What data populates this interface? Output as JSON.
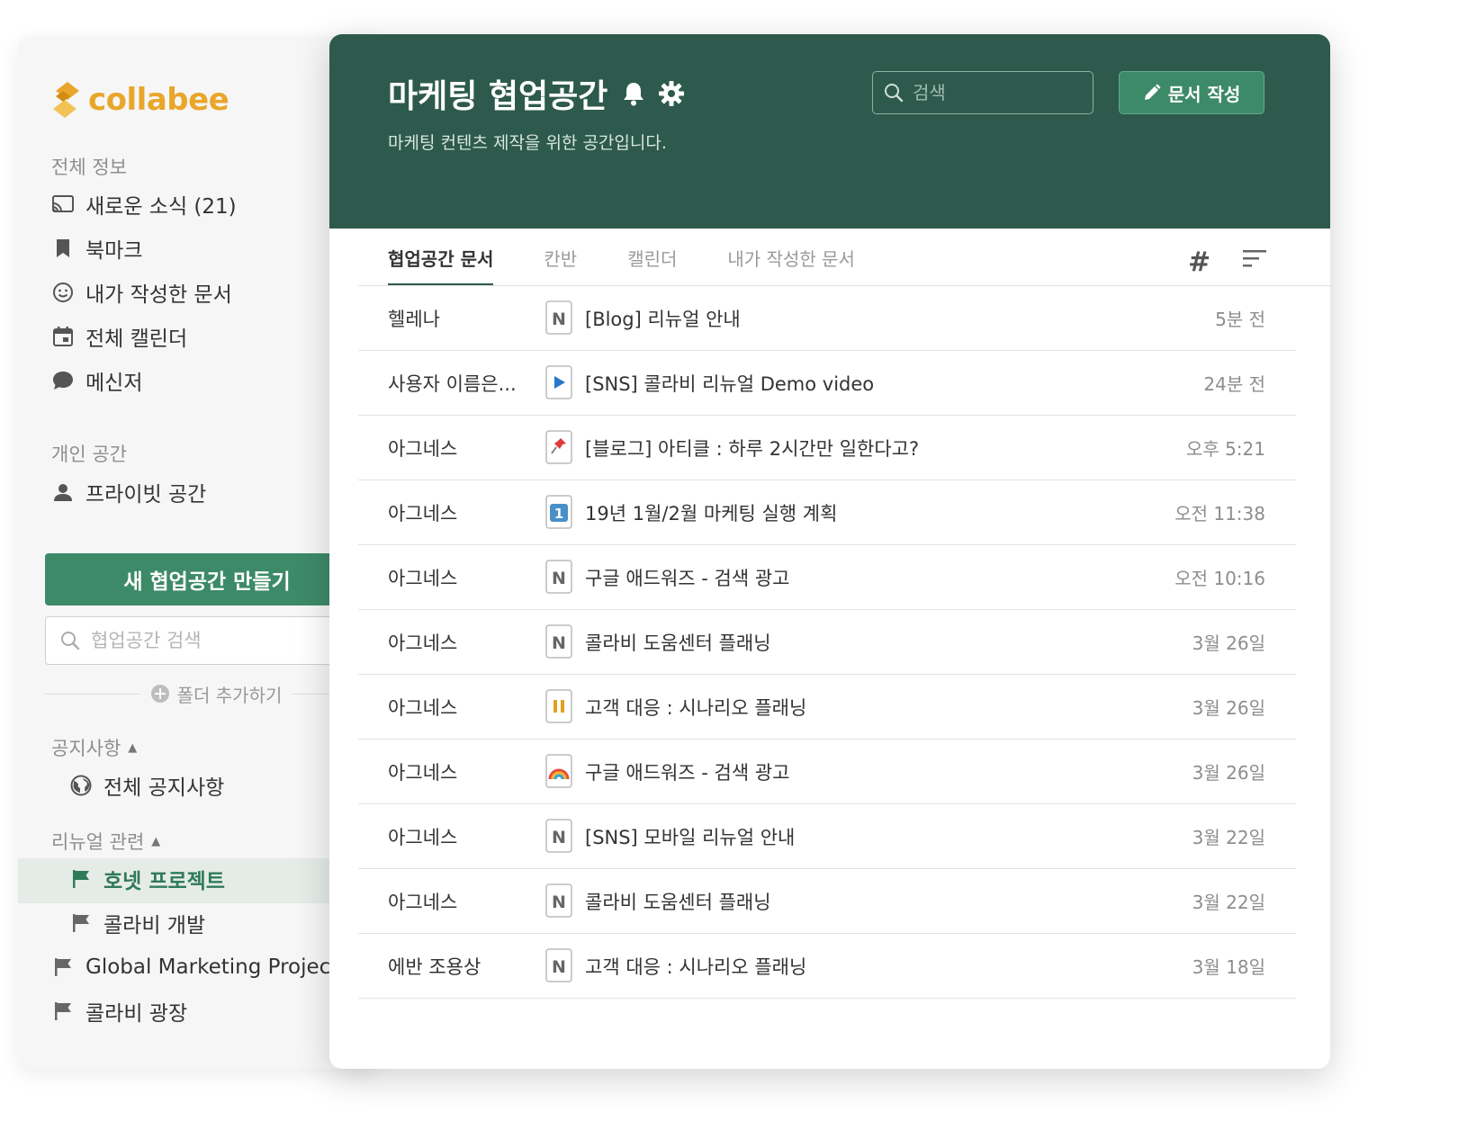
{
  "brand": {
    "name": "collabee",
    "color": "#e9a62b"
  },
  "colors": {
    "header_bg": "#2d5a4c",
    "accent": "#3d8a68"
  },
  "sidebar": {
    "section_all": "전체 정보",
    "items": [
      {
        "label": "새로운 소식 (21)",
        "icon": "cast-icon"
      },
      {
        "label": "북마크",
        "icon": "bookmark-icon"
      },
      {
        "label": "내가 작성한 문서",
        "icon": "smile-icon"
      },
      {
        "label": "전체 캘린더",
        "icon": "calendar-icon"
      },
      {
        "label": "메신저",
        "icon": "chat-bubble-icon"
      }
    ],
    "section_personal": "개인 공간",
    "private_space": "프라이빗 공간",
    "new_space_button": "새 협업공간 만들기",
    "space_search_placeholder": "협업공간 검색",
    "add_folder": "폴더 추가하기",
    "groups": [
      {
        "label": "공지사항",
        "items": [
          {
            "label": "전체 공지사항",
            "icon": "globe-icon"
          }
        ]
      },
      {
        "label": "리뉴얼 관련",
        "items": [
          {
            "label": "호넷 프로젝트",
            "icon": "flag-icon",
            "active": true
          },
          {
            "label": "콜라비 개발",
            "icon": "flag-icon"
          }
        ]
      }
    ],
    "other_spaces": [
      {
        "label": "Global Marketing Project...",
        "icon": "flag-icon"
      },
      {
        "label": "콜라비 광장",
        "icon": "flag-icon"
      }
    ]
  },
  "workspace": {
    "title": "마케팅 협업공간",
    "description": "마케팅 컨텐츠 제작을 위한 공간입니다.",
    "search_placeholder": "검색",
    "write_button": "문서 작성"
  },
  "tabs": [
    {
      "label": "협업공간 문서",
      "active": true
    },
    {
      "label": "칸반"
    },
    {
      "label": "캘린더"
    },
    {
      "label": "내가 작성한 문서"
    }
  ],
  "documents": [
    {
      "author": "헬레나",
      "icon": "n",
      "title": "[Blog] 리뉴얼 안내",
      "time": "5분 전"
    },
    {
      "author": "사용자 이름은...",
      "icon": "play",
      "title": "[SNS] 콜라비 리뉴얼 Demo video",
      "time": "24분 전"
    },
    {
      "author": "아그네스",
      "icon": "pin",
      "title": "[블로그] 아티클 : 하루 2시간만 일한다고?",
      "time": "오후 5:21"
    },
    {
      "author": "아그네스",
      "icon": "one",
      "title": "19년 1월/2월 마케팅 실행 계획",
      "time": "오전 11:38"
    },
    {
      "author": "아그네스",
      "icon": "n",
      "title": "구글 애드워즈 - 검색 광고",
      "time": "오전 10:16"
    },
    {
      "author": "아그네스",
      "icon": "n",
      "title": "콜라비 도움센터 플래닝",
      "time": "3월 26일"
    },
    {
      "author": "아그네스",
      "icon": "pause",
      "title": "고객 대응 : 시나리오 플래닝",
      "time": "3월 26일"
    },
    {
      "author": "아그네스",
      "icon": "rainbow",
      "title": "구글 애드워즈 - 검색 광고",
      "time": "3월 26일"
    },
    {
      "author": "아그네스",
      "icon": "n",
      "title": "[SNS] 모바일 리뉴얼 안내",
      "time": "3월 22일"
    },
    {
      "author": "아그네스",
      "icon": "n",
      "title": "콜라비 도움센터 플래닝",
      "time": "3월 22일"
    },
    {
      "author": "에반 조용상",
      "icon": "n",
      "title": "고객 대응 : 시나리오 플래닝",
      "time": "3월 18일"
    }
  ]
}
